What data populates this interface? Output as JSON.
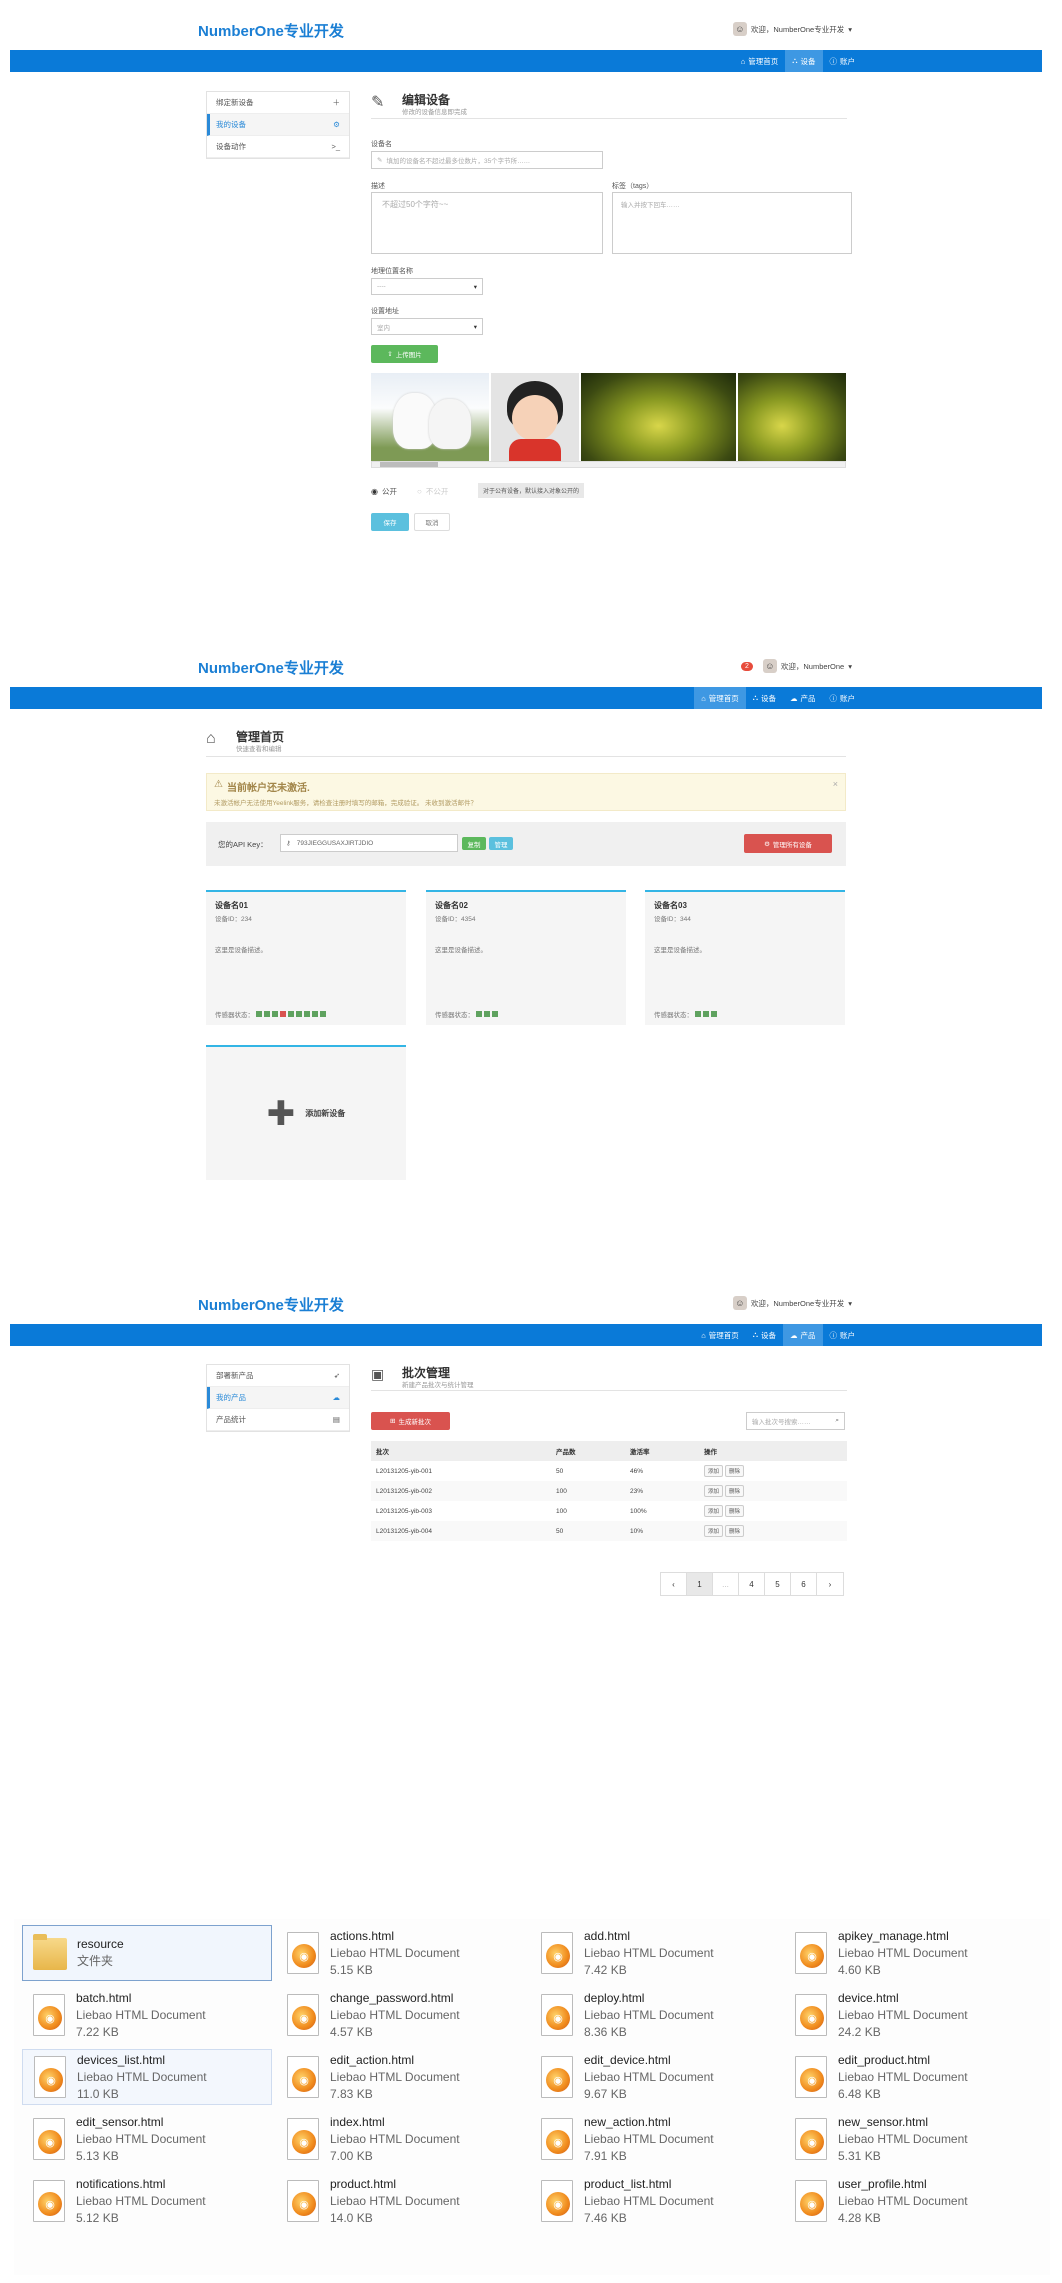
{
  "brand": "NumberOne专业开发",
  "s1": {
    "user": "欢迎，NumberOne专业开发",
    "nav": [
      "管理首页",
      "设备",
      "账户"
    ],
    "side": [
      "绑定新设备",
      "我的设备",
      "设备动作"
    ],
    "title": "编辑设备",
    "subtitle": "修改的设备信息即完成",
    "name_label": "设备名",
    "name_ph": "填加的设备名不超过最多位数片，35个字节所……",
    "desc_label": "描述",
    "desc_ph": "不超过50个字符~~",
    "tags_label": "标签（tags）",
    "tags_ph": "输入并按下回车……",
    "loc_label": "地理位置名称",
    "loc_val": "----",
    "type_label": "设置地址",
    "type_val": "室内",
    "upload": "上传图片",
    "pub": "公开",
    "priv": "不公开",
    "hint": "对于公有设备，默认接入对象公开的",
    "save": "保存",
    "cancel": "取消"
  },
  "s2": {
    "badge": "2",
    "user": "欢迎，NumberOne",
    "nav": [
      "管理首页",
      "设备",
      "产品",
      "账户"
    ],
    "title": "管理首页",
    "subtitle": "快速查看和编辑",
    "alert_title": "当前帐户还未激活.",
    "alert_text": "未激活帐户无法使用Yeelink服务，请检查注册时填写的邮箱，完成验证。 未收到激活邮件？",
    "api_label": "您的API Key：",
    "api_val": "793JIEGGUSAXJIRTJDIO",
    "copy": "复制",
    "manage": "管理",
    "manage_all": "管理所有设备",
    "devices": [
      {
        "name": "设备名01",
        "id": "设备ID：234",
        "desc": "这里是设备描述。",
        "status_label": "传感器状态：",
        "sensors": [
          "g",
          "g",
          "g",
          "r",
          "g",
          "g",
          "g",
          "g",
          "g"
        ]
      },
      {
        "name": "设备名02",
        "id": "设备ID：4354",
        "desc": "这里是设备描述。",
        "status_label": "传感器状态：",
        "sensors": [
          "g",
          "g",
          "g"
        ]
      },
      {
        "name": "设备名03",
        "id": "设备ID：344",
        "desc": "这里是设备描述。",
        "status_label": "传感器状态：",
        "sensors": [
          "g",
          "g",
          "g"
        ]
      }
    ],
    "add_device": "添加新设备"
  },
  "s3": {
    "user": "欢迎，NumberOne专业开发",
    "nav": [
      "管理首页",
      "设备",
      "产品",
      "账户"
    ],
    "side": [
      "部署新产品",
      "我的产品",
      "产品统计"
    ],
    "title": "批次管理",
    "subtitle": "新建产品批次与统计管理",
    "gen_btn": "生成新批次",
    "search_ph": "输入批次号搜索……",
    "cols": [
      "批次",
      "产品数",
      "激活率",
      "操作"
    ],
    "rows": [
      [
        "L20131205-yib-001",
        "50",
        "46%"
      ],
      [
        "L20131205-yib-002",
        "100",
        "23%"
      ],
      [
        "L20131205-yib-003",
        "100",
        "100%"
      ],
      [
        "L20131205-yib-004",
        "50",
        "10%"
      ]
    ],
    "act_add": "添加",
    "act_del": "删除",
    "pages": [
      "1",
      "...",
      "4",
      "5",
      "6"
    ]
  },
  "files": [
    {
      "name": "resource",
      "type": "文件夹",
      "size": ""
    },
    {
      "name": "actions.html",
      "type": "Liebao HTML Document",
      "size": "5.15 KB"
    },
    {
      "name": "add.html",
      "type": "Liebao HTML Document",
      "size": "7.42 KB"
    },
    {
      "name": "apikey_manage.html",
      "type": "Liebao HTML Document",
      "size": "4.60 KB"
    },
    {
      "name": "batch.html",
      "type": "Liebao HTML Document",
      "size": "7.22 KB"
    },
    {
      "name": "change_password.html",
      "type": "Liebao HTML Document",
      "size": "4.57 KB"
    },
    {
      "name": "deploy.html",
      "type": "Liebao HTML Document",
      "size": "8.36 KB"
    },
    {
      "name": "device.html",
      "type": "Liebao HTML Document",
      "size": "24.2 KB"
    },
    {
      "name": "devices_list.html",
      "type": "Liebao HTML Document",
      "size": "11.0 KB"
    },
    {
      "name": "edit_action.html",
      "type": "Liebao HTML Document",
      "size": "7.83 KB"
    },
    {
      "name": "edit_device.html",
      "type": "Liebao HTML Document",
      "size": "9.67 KB"
    },
    {
      "name": "edit_product.html",
      "type": "Liebao HTML Document",
      "size": "6.48 KB"
    },
    {
      "name": "edit_sensor.html",
      "type": "Liebao HTML Document",
      "size": "5.13 KB"
    },
    {
      "name": "index.html",
      "type": "Liebao HTML Document",
      "size": "7.00 KB"
    },
    {
      "name": "new_action.html",
      "type": "Liebao HTML Document",
      "size": "7.91 KB"
    },
    {
      "name": "new_sensor.html",
      "type": "Liebao HTML Document",
      "size": "5.31 KB"
    },
    {
      "name": "notifications.html",
      "type": "Liebao HTML Document",
      "size": "5.12 KB"
    },
    {
      "name": "product.html",
      "type": "Liebao HTML Document",
      "size": "14.0 KB"
    },
    {
      "name": "product_list.html",
      "type": "Liebao HTML Document",
      "size": "7.46 KB"
    },
    {
      "name": "user_profile.html",
      "type": "Liebao HTML Document",
      "size": "4.28 KB"
    }
  ]
}
